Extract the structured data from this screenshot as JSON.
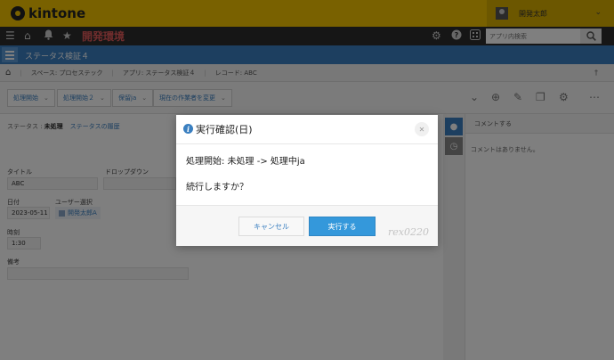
{
  "brand": {
    "logo_text": "kintone",
    "brand_color": "#f2c200"
  },
  "user": {
    "name": "開発太郎"
  },
  "nav": {
    "env_label": "開発環境",
    "search_placeholder": "アプリ内検索",
    "icons": [
      "menu-icon",
      "home-icon",
      "bell-icon",
      "star-icon",
      "gear-icon",
      "help-icon",
      "apps-icon",
      "search-icon"
    ]
  },
  "app": {
    "title": "ステータス検証４"
  },
  "breadcrumb": {
    "items": [
      "スペース: プロセステック",
      "アプリ: ステータス検証４",
      "レコード: ABC"
    ]
  },
  "actions": {
    "buttons": [
      "処理開始",
      "処理開始２",
      "保留ja",
      "現在の作業者を変更"
    ]
  },
  "record": {
    "status_label": "ステータス :",
    "status_value": "未処理",
    "history_link": "ステータスの履歴",
    "fields": {
      "title_label": "タイトル",
      "title_value": "ABC",
      "dropdown_label": "ドロップダウン",
      "date_label": "日付",
      "date_value": "2023-05-11",
      "user_select_label": "ユーザー選択",
      "user_select_value": "開発太郎A",
      "time_label": "時刻",
      "time_value": "1:30",
      "notes_label": "備考"
    }
  },
  "comments": {
    "header": "コメントする",
    "empty": "コメントはありません。"
  },
  "dialog": {
    "title": "実行確認(日)",
    "message_line1": "処理開始: 未処理 -> 処理中ja",
    "message_line2": "続行しますか？",
    "cancel_label": "キャンセル",
    "ok_label": "実行する",
    "watermark": "rex0220",
    "accent_color": "#3498db"
  }
}
